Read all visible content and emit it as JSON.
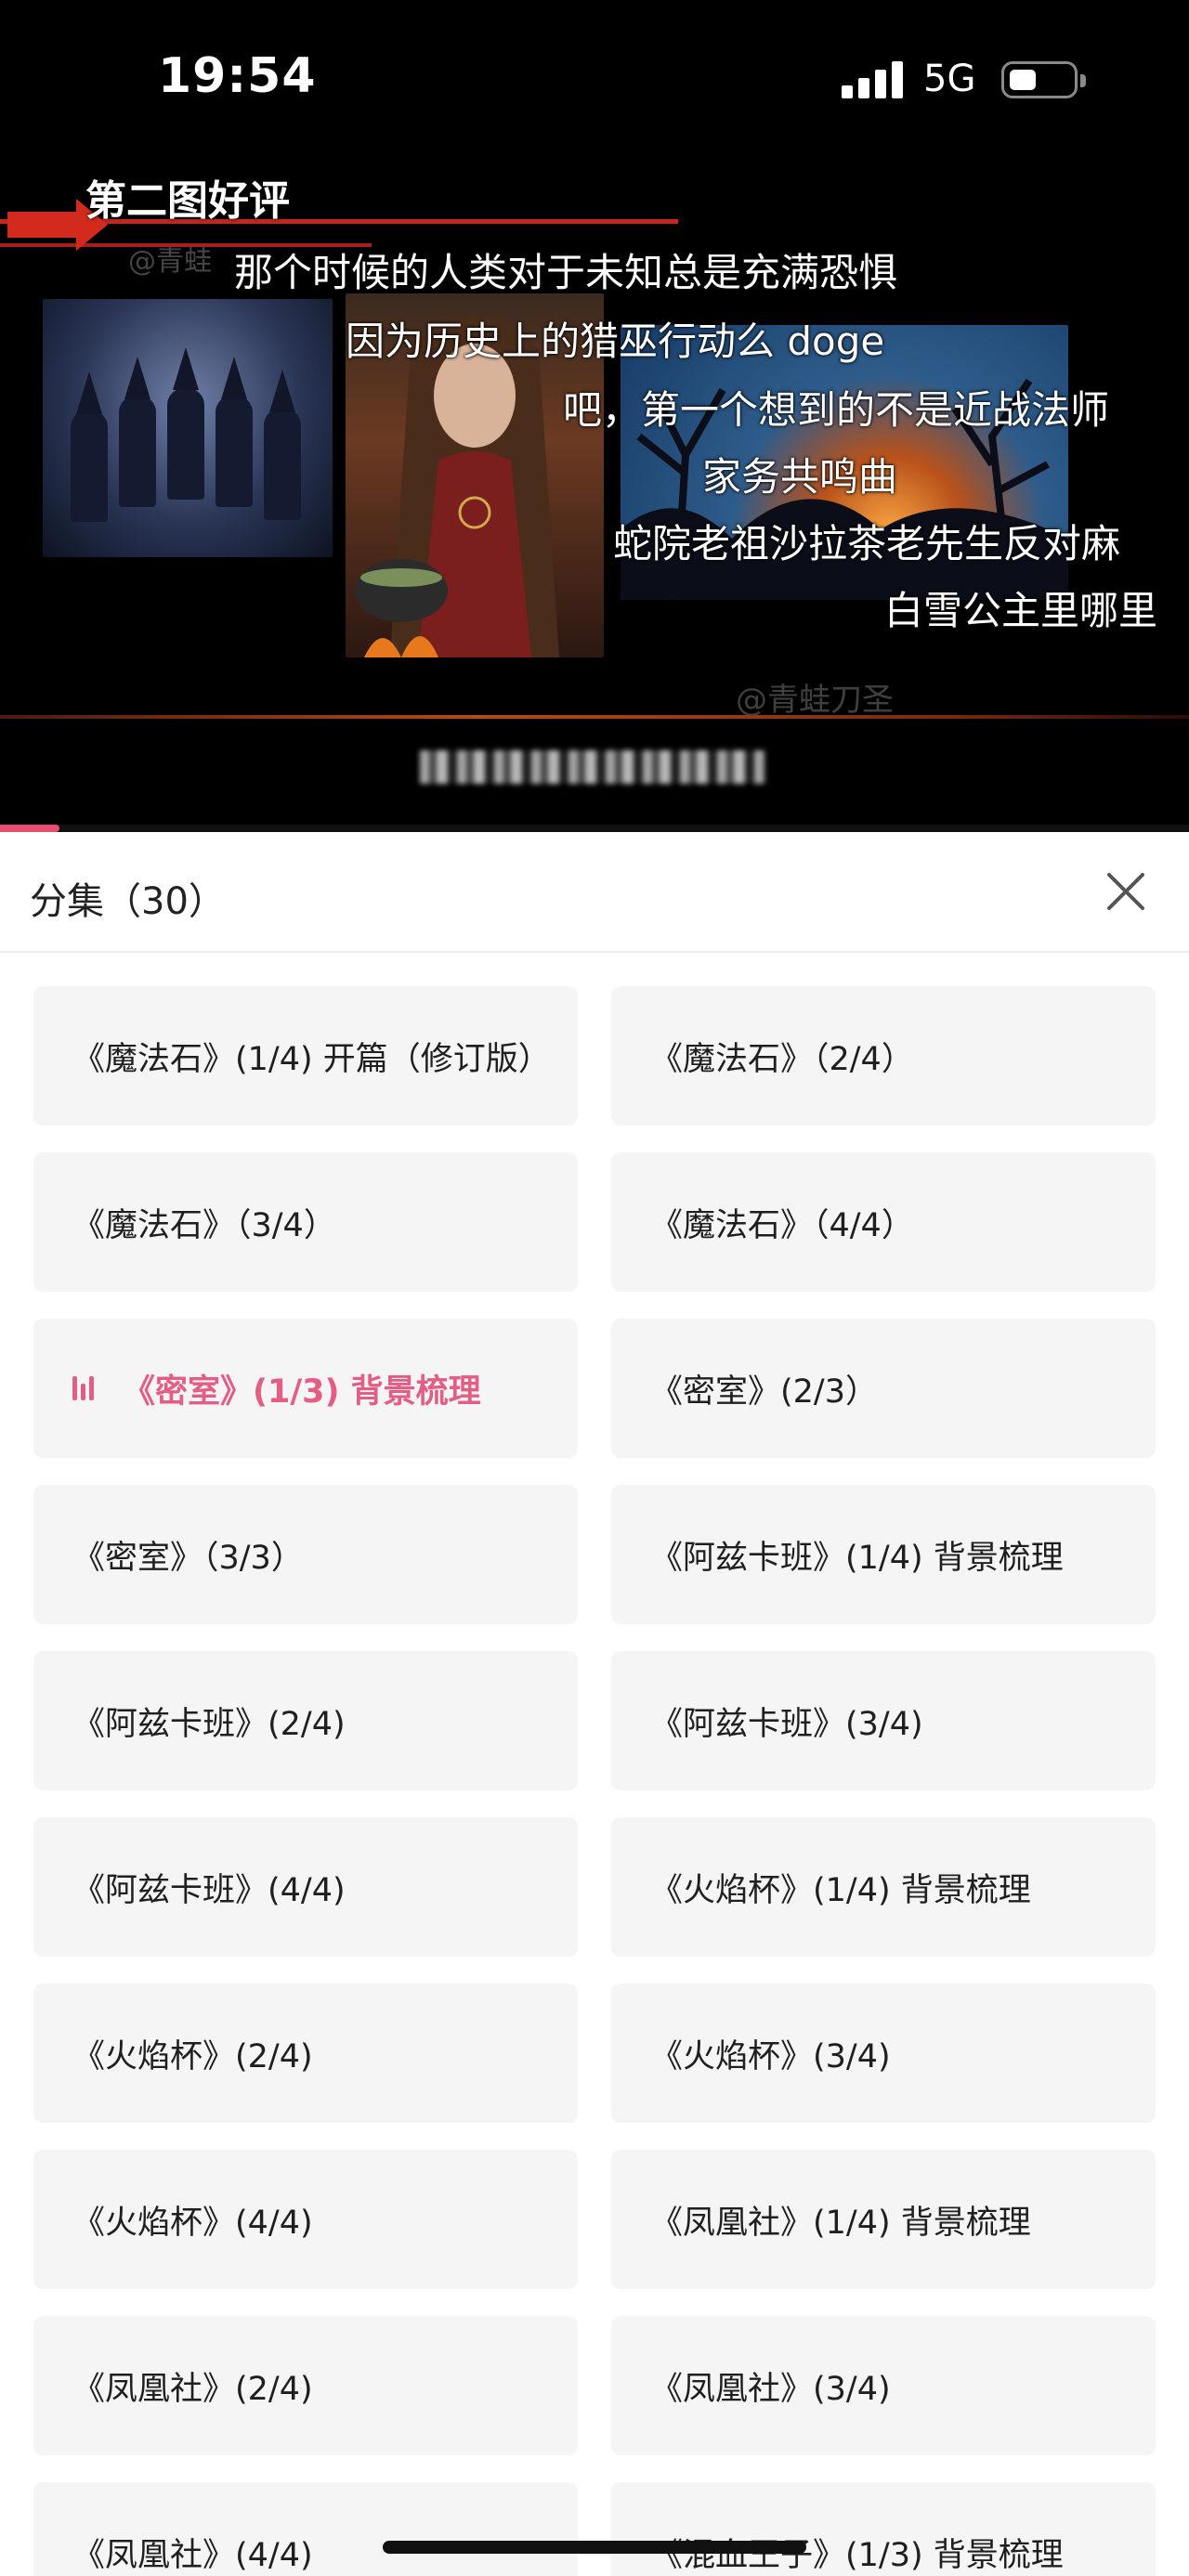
{
  "status_bar": {
    "time": "19:54",
    "network": "5G",
    "icons": [
      "signal-icon",
      "battery-icon"
    ]
  },
  "video": {
    "episode_caption": "第二图好评",
    "watermark": "@青蛙刀圣",
    "watermark_partial": "@青蛙",
    "danmaku": [
      "那个时候的人类对于未知总是充满恐惧",
      "因为历史上的猎巫行动么 doge",
      "吧，第一个想到的不是近战法师",
      "家务共鸣曲",
      "蛇院老祖沙拉茶老先生反对麻",
      "白雪公主里哪里"
    ],
    "progress_fraction": 0.05
  },
  "panel": {
    "title": "分集（30）",
    "close_icon": "close-icon",
    "episodes": [
      {
        "label": "《魔法石》(1/4) 开篇（修订版）",
        "active": false
      },
      {
        "label": "《魔法石》（2/4）",
        "active": false
      },
      {
        "label": "《魔法石》（3/4）",
        "active": false
      },
      {
        "label": "《魔法石》（4/4）",
        "active": false
      },
      {
        "label": "《密室》(1/3) 背景梳理",
        "active": true
      },
      {
        "label": "《密室》(2/3）",
        "active": false
      },
      {
        "label": "《密室》（3/3）",
        "active": false
      },
      {
        "label": "《阿兹卡班》(1/4) 背景梳理",
        "active": false
      },
      {
        "label": "《阿兹卡班》(2/4)",
        "active": false
      },
      {
        "label": "《阿兹卡班》(3/4)",
        "active": false
      },
      {
        "label": "《阿兹卡班》(4/4)",
        "active": false
      },
      {
        "label": "《火焰杯》(1/4) 背景梳理",
        "active": false
      },
      {
        "label": "《火焰杯》(2/4)",
        "active": false
      },
      {
        "label": "《火焰杯》(3/4)",
        "active": false
      },
      {
        "label": "《火焰杯》(4/4)",
        "active": false
      },
      {
        "label": "《凤凰社》(1/4) 背景梳理",
        "active": false
      },
      {
        "label": "《凤凰社》(2/4)",
        "active": false
      },
      {
        "label": "《凤凰社》(3/4)",
        "active": false
      },
      {
        "label": "《凤凰社》(4/4)",
        "active": false
      },
      {
        "label": "《混血王子》(1/3) 背景梳理",
        "active": false
      }
    ]
  },
  "colors": {
    "accent": "#e45d84",
    "item_bg": "#f5f5f5",
    "video_bg": "#000000"
  }
}
